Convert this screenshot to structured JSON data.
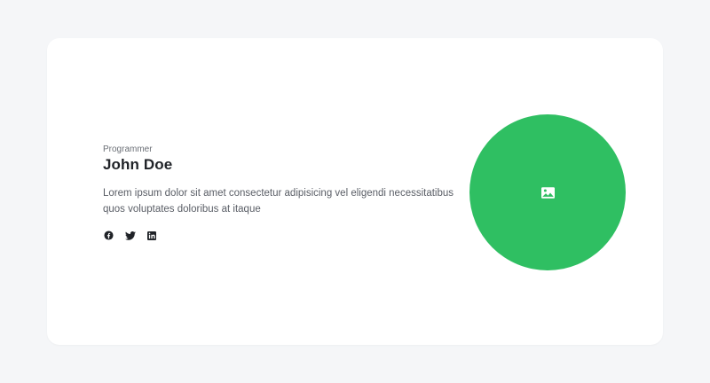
{
  "profile": {
    "role": "Programmer",
    "name": "John Doe",
    "description": "Lorem ipsum dolor sit amet consectetur adipisicing vel eligendi necessitatibus quos voluptates doloribus at itaque"
  },
  "socials": [
    {
      "icon": "facebook-icon"
    },
    {
      "icon": "twitter-icon"
    },
    {
      "icon": "linkedin-icon"
    }
  ],
  "avatar": {
    "icon": "image-icon",
    "background": "#2fbf62"
  }
}
